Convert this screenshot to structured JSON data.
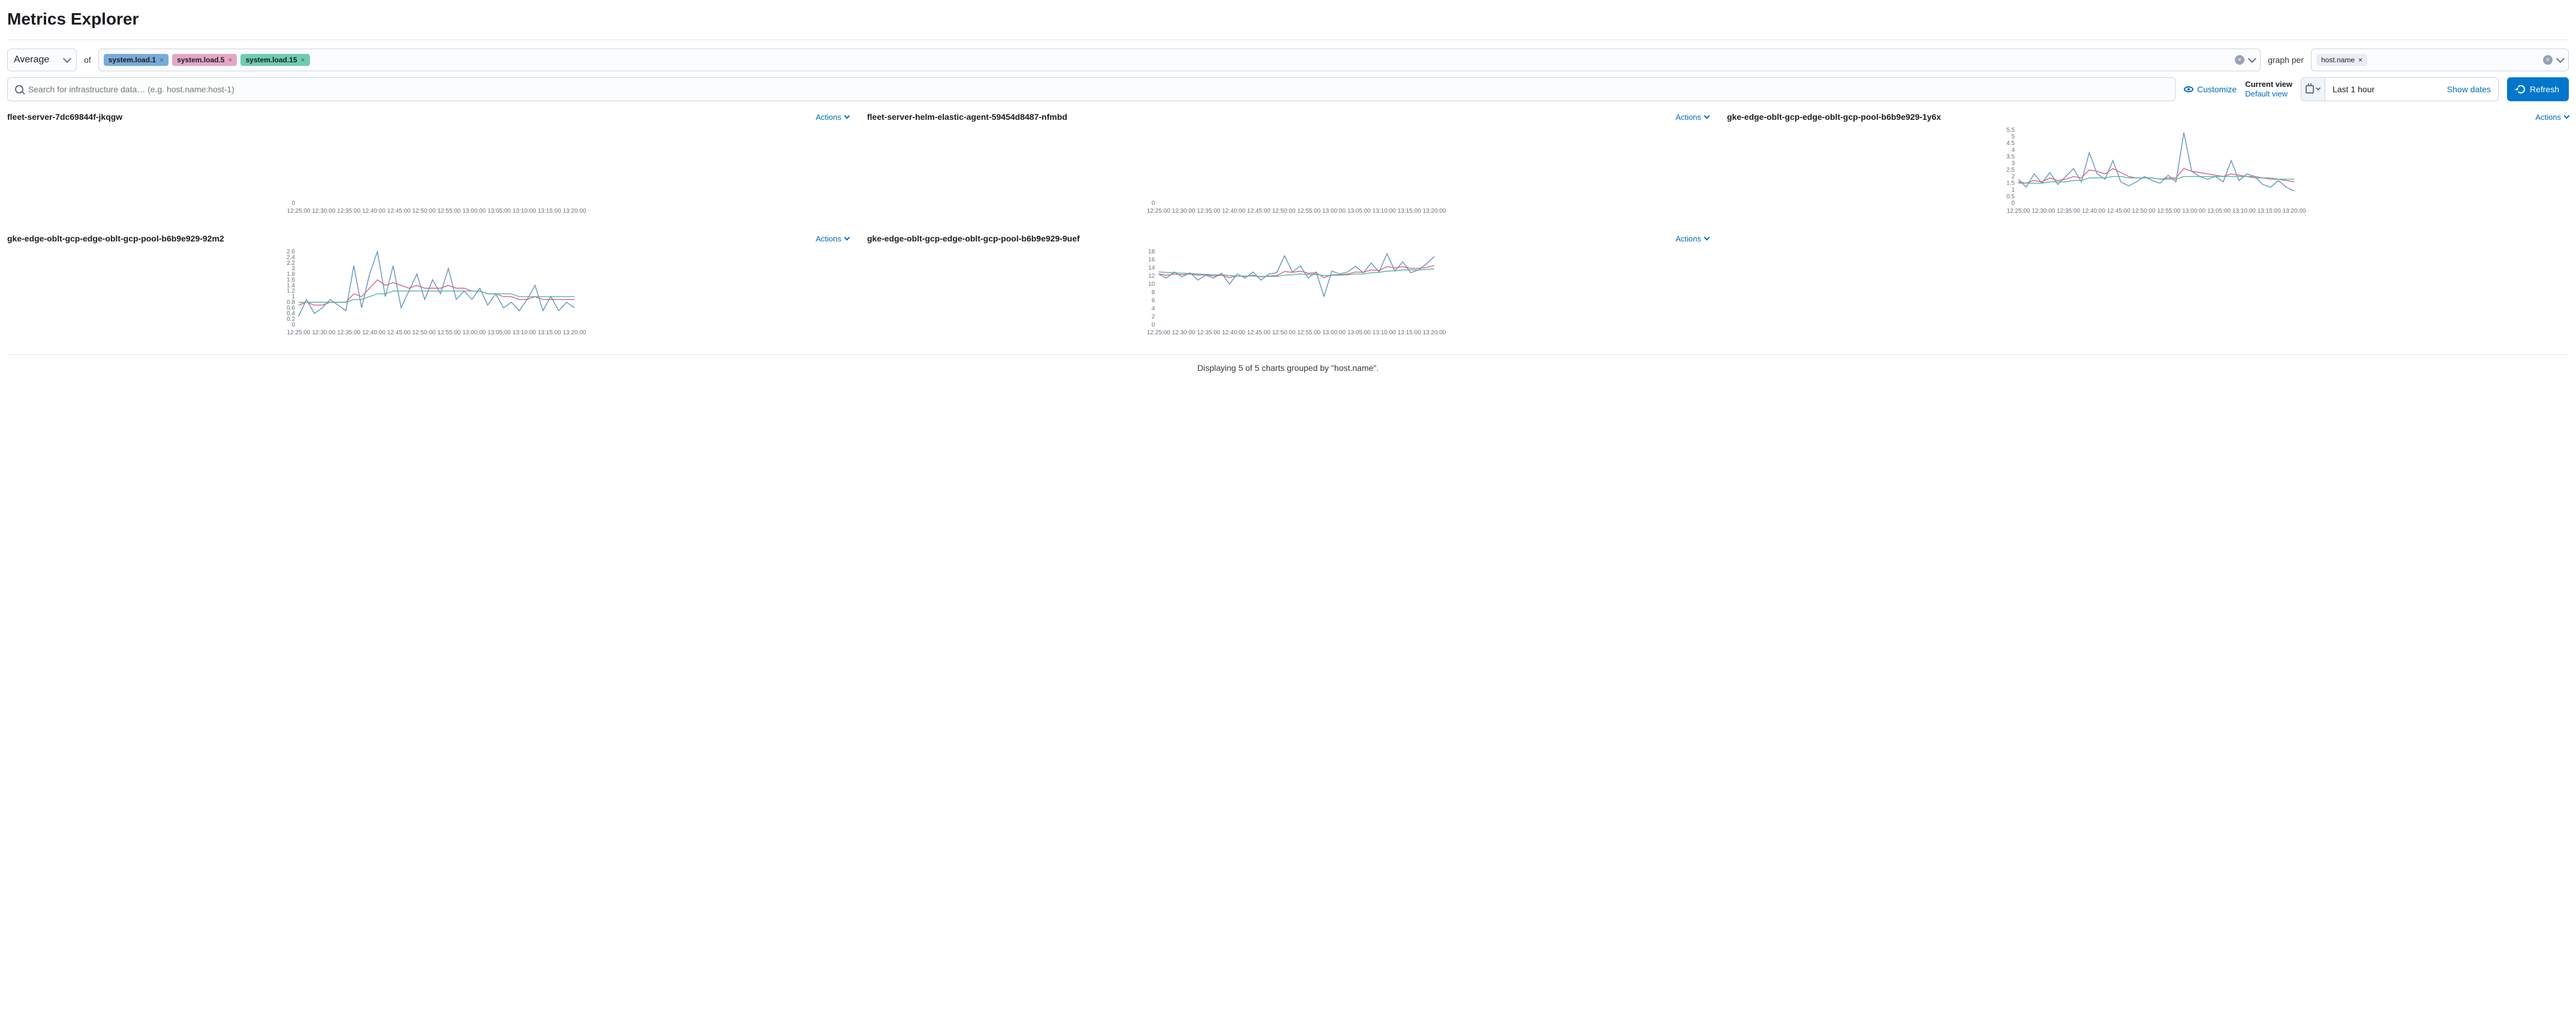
{
  "page_title": "Metrics Explorer",
  "aggregation": {
    "selected": "Average"
  },
  "of_label": "of",
  "metrics": [
    {
      "label": "system.load.1",
      "color": "pill-blue"
    },
    {
      "label": "system.load.5",
      "color": "pill-pink"
    },
    {
      "label": "system.load.15",
      "color": "pill-green"
    }
  ],
  "graph_per": {
    "label": "graph per",
    "pills": [
      "host.name"
    ]
  },
  "search": {
    "placeholder": "Search for infrastructure data… (e.g. host.name:host-1)"
  },
  "customize_label": "Customize",
  "view": {
    "current": "Current view",
    "default": "Default view"
  },
  "date_picker": {
    "value": "Last 1 hour",
    "show_dates": "Show dates"
  },
  "refresh_label": "Refresh",
  "actions_label": "Actions",
  "footer": "Displaying 5 of 5 charts grouped by \"host.name\".",
  "x_ticks": [
    "12:25:00",
    "12:30:00",
    "12:35:00",
    "12:40:00",
    "12:45:00",
    "12:50:00",
    "12:55:00",
    "13:00:00",
    "13:05:00",
    "13:10:00",
    "13:15:00",
    "13:20:00"
  ],
  "chart_data": [
    {
      "title": "fleet-server-7dc69844f-jkqgw",
      "type": "line",
      "xlabel": "",
      "ylabel": "",
      "ylim": [
        0,
        0
      ],
      "y_ticks": [
        0
      ],
      "x": [
        "12:25:00",
        "12:30:00",
        "12:35:00",
        "12:40:00",
        "12:45:00",
        "12:50:00",
        "12:55:00",
        "13:00:00",
        "13:05:00",
        "13:10:00",
        "13:15:00",
        "13:20:00"
      ],
      "series": [
        {
          "name": "system.load.1",
          "values": []
        },
        {
          "name": "system.load.5",
          "values": []
        },
        {
          "name": "system.load.15",
          "values": []
        }
      ]
    },
    {
      "title": "fleet-server-helm-elastic-agent-59454d8487-nfmbd",
      "type": "line",
      "xlabel": "",
      "ylabel": "",
      "ylim": [
        0,
        0
      ],
      "y_ticks": [
        0
      ],
      "x": [
        "12:25:00",
        "12:30:00",
        "12:35:00",
        "12:40:00",
        "12:45:00",
        "12:50:00",
        "12:55:00",
        "13:00:00",
        "13:05:00",
        "13:10:00",
        "13:15:00",
        "13:20:00"
      ],
      "series": [
        {
          "name": "system.load.1",
          "values": []
        },
        {
          "name": "system.load.5",
          "values": []
        },
        {
          "name": "system.load.15",
          "values": []
        }
      ]
    },
    {
      "title": "gke-edge-oblt-gcp-edge-oblt-gcp-pool-b6b9e929-1y6x",
      "type": "line",
      "xlabel": "",
      "ylabel": "",
      "ylim": [
        0,
        5.5
      ],
      "y_ticks": [
        0,
        0.5,
        1,
        1.5,
        2,
        2.5,
        3,
        3.5,
        4,
        4.5,
        5,
        5.5
      ],
      "x": [
        "12:25:00",
        "12:30:00",
        "12:35:00",
        "12:40:00",
        "12:45:00",
        "12:50:00",
        "12:55:00",
        "13:00:00",
        "13:05:00",
        "13:10:00",
        "13:15:00",
        "13:20:00"
      ],
      "series": [
        {
          "name": "system.load.1",
          "values": [
            1.8,
            1.2,
            2.2,
            1.5,
            2.3,
            1.4,
            2.0,
            2.6,
            1.6,
            3.8,
            2.2,
            1.8,
            3.2,
            1.6,
            1.3,
            1.6,
            2.0,
            1.7,
            1.5,
            2.1,
            1.6,
            5.3,
            2.4,
            2.0,
            1.8,
            2.0,
            1.6,
            3.2,
            1.7,
            2.2,
            2.0,
            1.4,
            1.2,
            1.7,
            1.2,
            0.9
          ]
        },
        {
          "name": "system.load.5",
          "values": [
            1.6,
            1.5,
            1.7,
            1.6,
            1.9,
            1.7,
            1.8,
            2.0,
            1.9,
            2.5,
            2.4,
            2.2,
            2.6,
            2.3,
            2.0,
            1.9,
            1.9,
            1.9,
            1.8,
            1.9,
            1.9,
            2.6,
            2.4,
            2.3,
            2.2,
            2.1,
            2.0,
            2.2,
            2.1,
            2.0,
            2.0,
            1.9,
            1.8,
            1.8,
            1.7,
            1.6
          ]
        },
        {
          "name": "system.load.15",
          "values": [
            1.5,
            1.5,
            1.5,
            1.5,
            1.6,
            1.6,
            1.6,
            1.7,
            1.7,
            1.9,
            1.9,
            1.9,
            2.0,
            2.0,
            1.9,
            1.9,
            1.9,
            1.9,
            1.8,
            1.8,
            1.8,
            2.0,
            2.0,
            2.0,
            2.0,
            2.0,
            2.0,
            2.0,
            2.0,
            2.0,
            1.9,
            1.9,
            1.9,
            1.8,
            1.8,
            1.8
          ]
        }
      ]
    },
    {
      "title": "gke-edge-oblt-gcp-edge-oblt-gcp-pool-b6b9e929-92m2",
      "type": "line",
      "xlabel": "",
      "ylabel": "",
      "ylim": [
        0,
        2.6
      ],
      "y_ticks": [
        0,
        0.2,
        0.4,
        0.6,
        0.8,
        1,
        1.2,
        1.4,
        1.6,
        1.8,
        2,
        2.2,
        2.4,
        2.6
      ],
      "x": [
        "12:25:00",
        "12:30:00",
        "12:35:00",
        "12:40:00",
        "12:45:00",
        "12:50:00",
        "12:55:00",
        "13:00:00",
        "13:05:00",
        "13:10:00",
        "13:15:00",
        "13:20:00"
      ],
      "series": [
        {
          "name": "system.load.1",
          "values": [
            0.3,
            0.9,
            0.4,
            0.6,
            0.9,
            0.7,
            0.5,
            2.1,
            0.6,
            1.8,
            2.6,
            1.0,
            2.1,
            0.6,
            1.2,
            1.8,
            0.9,
            1.6,
            1.1,
            2.0,
            0.9,
            1.2,
            0.9,
            1.3,
            0.7,
            1.1,
            0.6,
            0.8,
            0.5,
            0.9,
            1.4,
            0.5,
            1.0,
            0.5,
            0.8,
            0.6
          ]
        },
        {
          "name": "system.load.5",
          "values": [
            0.7,
            0.8,
            0.7,
            0.7,
            0.8,
            0.8,
            0.8,
            1.1,
            1.0,
            1.3,
            1.6,
            1.4,
            1.5,
            1.4,
            1.3,
            1.4,
            1.3,
            1.3,
            1.3,
            1.4,
            1.3,
            1.3,
            1.2,
            1.2,
            1.1,
            1.1,
            1.0,
            1.0,
            0.9,
            0.9,
            1.0,
            0.9,
            0.9,
            0.9,
            0.9,
            0.9
          ]
        },
        {
          "name": "system.load.15",
          "values": [
            0.8,
            0.8,
            0.8,
            0.8,
            0.8,
            0.8,
            0.8,
            0.9,
            0.9,
            1.0,
            1.1,
            1.1,
            1.2,
            1.2,
            1.2,
            1.2,
            1.2,
            1.2,
            1.2,
            1.2,
            1.2,
            1.2,
            1.2,
            1.2,
            1.1,
            1.1,
            1.1,
            1.1,
            1.0,
            1.0,
            1.0,
            1.0,
            1.0,
            1.0,
            1.0,
            1.0
          ]
        }
      ]
    },
    {
      "title": "gke-edge-oblt-gcp-edge-oblt-gcp-pool-b6b9e929-9uef",
      "type": "line",
      "xlabel": "",
      "ylabel": "",
      "ylim": [
        0,
        18
      ],
      "y_ticks": [
        0,
        2,
        4,
        6,
        8,
        10,
        12,
        14,
        16,
        18
      ],
      "x": [
        "12:25:00",
        "12:30:00",
        "12:35:00",
        "12:40:00",
        "12:45:00",
        "12:50:00",
        "12:55:00",
        "13:00:00",
        "13:05:00",
        "13:10:00",
        "13:15:00",
        "13:20:00"
      ],
      "series": [
        {
          "name": "system.load.1",
          "values": [
            12.5,
            11.5,
            13.0,
            11.8,
            12.8,
            11.0,
            12.2,
            11.5,
            12.7,
            10.0,
            12.5,
            11.5,
            13.0,
            11.0,
            12.5,
            12.8,
            17.0,
            13.0,
            14.5,
            11.5,
            13.0,
            7.0,
            13.2,
            12.5,
            13.0,
            14.4,
            12.8,
            15.2,
            13.0,
            17.5,
            13.2,
            15.5,
            12.8,
            13.5,
            15.0,
            16.8
          ]
        },
        {
          "name": "system.load.5",
          "values": [
            12.5,
            12.2,
            12.5,
            12.3,
            12.5,
            12.2,
            12.3,
            12.0,
            12.2,
            11.6,
            12.0,
            11.9,
            12.2,
            11.8,
            12.0,
            12.1,
            13.1,
            12.9,
            13.2,
            12.7,
            12.8,
            11.6,
            12.3,
            12.3,
            12.5,
            13.0,
            12.9,
            13.5,
            13.4,
            14.3,
            14.0,
            14.3,
            13.9,
            13.9,
            14.1,
            14.6
          ]
        },
        {
          "name": "system.load.15",
          "values": [
            13.0,
            12.9,
            12.8,
            12.7,
            12.6,
            12.5,
            12.4,
            12.3,
            12.3,
            12.1,
            12.0,
            12.0,
            12.0,
            11.9,
            11.9,
            11.9,
            12.2,
            12.3,
            12.5,
            12.4,
            12.4,
            12.1,
            12.2,
            12.2,
            12.3,
            12.5,
            12.5,
            12.8,
            12.9,
            13.2,
            13.3,
            13.5,
            13.5,
            13.5,
            13.6,
            13.8
          ]
        }
      ]
    }
  ]
}
